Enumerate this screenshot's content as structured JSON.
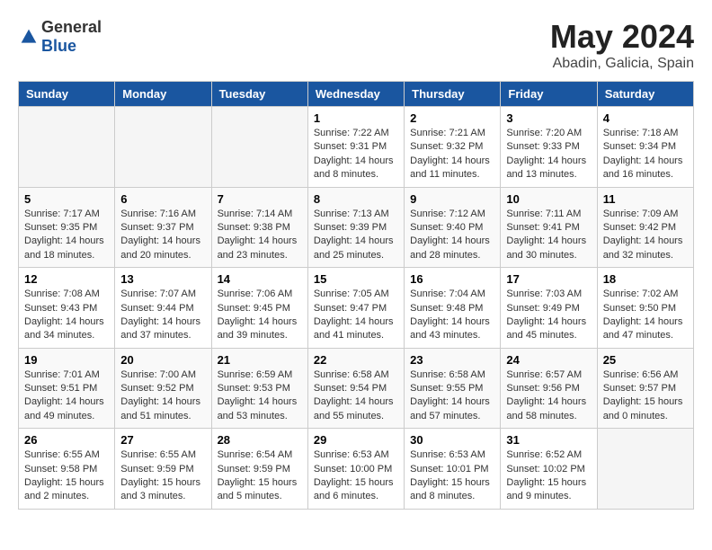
{
  "header": {
    "logo_general": "General",
    "logo_blue": "Blue",
    "month_year": "May 2024",
    "location": "Abadin, Galicia, Spain"
  },
  "weekdays": [
    "Sunday",
    "Monday",
    "Tuesday",
    "Wednesday",
    "Thursday",
    "Friday",
    "Saturday"
  ],
  "weeks": [
    [
      {
        "day": "",
        "sunrise": "",
        "sunset": "",
        "daylight": "",
        "empty": true
      },
      {
        "day": "",
        "sunrise": "",
        "sunset": "",
        "daylight": "",
        "empty": true
      },
      {
        "day": "",
        "sunrise": "",
        "sunset": "",
        "daylight": "",
        "empty": true
      },
      {
        "day": "1",
        "sunrise": "Sunrise: 7:22 AM",
        "sunset": "Sunset: 9:31 PM",
        "daylight": "Daylight: 14 hours and 8 minutes.",
        "empty": false
      },
      {
        "day": "2",
        "sunrise": "Sunrise: 7:21 AM",
        "sunset": "Sunset: 9:32 PM",
        "daylight": "Daylight: 14 hours and 11 minutes.",
        "empty": false
      },
      {
        "day": "3",
        "sunrise": "Sunrise: 7:20 AM",
        "sunset": "Sunset: 9:33 PM",
        "daylight": "Daylight: 14 hours and 13 minutes.",
        "empty": false
      },
      {
        "day": "4",
        "sunrise": "Sunrise: 7:18 AM",
        "sunset": "Sunset: 9:34 PM",
        "daylight": "Daylight: 14 hours and 16 minutes.",
        "empty": false
      }
    ],
    [
      {
        "day": "5",
        "sunrise": "Sunrise: 7:17 AM",
        "sunset": "Sunset: 9:35 PM",
        "daylight": "Daylight: 14 hours and 18 minutes.",
        "empty": false
      },
      {
        "day": "6",
        "sunrise": "Sunrise: 7:16 AM",
        "sunset": "Sunset: 9:37 PM",
        "daylight": "Daylight: 14 hours and 20 minutes.",
        "empty": false
      },
      {
        "day": "7",
        "sunrise": "Sunrise: 7:14 AM",
        "sunset": "Sunset: 9:38 PM",
        "daylight": "Daylight: 14 hours and 23 minutes.",
        "empty": false
      },
      {
        "day": "8",
        "sunrise": "Sunrise: 7:13 AM",
        "sunset": "Sunset: 9:39 PM",
        "daylight": "Daylight: 14 hours and 25 minutes.",
        "empty": false
      },
      {
        "day": "9",
        "sunrise": "Sunrise: 7:12 AM",
        "sunset": "Sunset: 9:40 PM",
        "daylight": "Daylight: 14 hours and 28 minutes.",
        "empty": false
      },
      {
        "day": "10",
        "sunrise": "Sunrise: 7:11 AM",
        "sunset": "Sunset: 9:41 PM",
        "daylight": "Daylight: 14 hours and 30 minutes.",
        "empty": false
      },
      {
        "day": "11",
        "sunrise": "Sunrise: 7:09 AM",
        "sunset": "Sunset: 9:42 PM",
        "daylight": "Daylight: 14 hours and 32 minutes.",
        "empty": false
      }
    ],
    [
      {
        "day": "12",
        "sunrise": "Sunrise: 7:08 AM",
        "sunset": "Sunset: 9:43 PM",
        "daylight": "Daylight: 14 hours and 34 minutes.",
        "empty": false
      },
      {
        "day": "13",
        "sunrise": "Sunrise: 7:07 AM",
        "sunset": "Sunset: 9:44 PM",
        "daylight": "Daylight: 14 hours and 37 minutes.",
        "empty": false
      },
      {
        "day": "14",
        "sunrise": "Sunrise: 7:06 AM",
        "sunset": "Sunset: 9:45 PM",
        "daylight": "Daylight: 14 hours and 39 minutes.",
        "empty": false
      },
      {
        "day": "15",
        "sunrise": "Sunrise: 7:05 AM",
        "sunset": "Sunset: 9:47 PM",
        "daylight": "Daylight: 14 hours and 41 minutes.",
        "empty": false
      },
      {
        "day": "16",
        "sunrise": "Sunrise: 7:04 AM",
        "sunset": "Sunset: 9:48 PM",
        "daylight": "Daylight: 14 hours and 43 minutes.",
        "empty": false
      },
      {
        "day": "17",
        "sunrise": "Sunrise: 7:03 AM",
        "sunset": "Sunset: 9:49 PM",
        "daylight": "Daylight: 14 hours and 45 minutes.",
        "empty": false
      },
      {
        "day": "18",
        "sunrise": "Sunrise: 7:02 AM",
        "sunset": "Sunset: 9:50 PM",
        "daylight": "Daylight: 14 hours and 47 minutes.",
        "empty": false
      }
    ],
    [
      {
        "day": "19",
        "sunrise": "Sunrise: 7:01 AM",
        "sunset": "Sunset: 9:51 PM",
        "daylight": "Daylight: 14 hours and 49 minutes.",
        "empty": false
      },
      {
        "day": "20",
        "sunrise": "Sunrise: 7:00 AM",
        "sunset": "Sunset: 9:52 PM",
        "daylight": "Daylight: 14 hours and 51 minutes.",
        "empty": false
      },
      {
        "day": "21",
        "sunrise": "Sunrise: 6:59 AM",
        "sunset": "Sunset: 9:53 PM",
        "daylight": "Daylight: 14 hours and 53 minutes.",
        "empty": false
      },
      {
        "day": "22",
        "sunrise": "Sunrise: 6:58 AM",
        "sunset": "Sunset: 9:54 PM",
        "daylight": "Daylight: 14 hours and 55 minutes.",
        "empty": false
      },
      {
        "day": "23",
        "sunrise": "Sunrise: 6:58 AM",
        "sunset": "Sunset: 9:55 PM",
        "daylight": "Daylight: 14 hours and 57 minutes.",
        "empty": false
      },
      {
        "day": "24",
        "sunrise": "Sunrise: 6:57 AM",
        "sunset": "Sunset: 9:56 PM",
        "daylight": "Daylight: 14 hours and 58 minutes.",
        "empty": false
      },
      {
        "day": "25",
        "sunrise": "Sunrise: 6:56 AM",
        "sunset": "Sunset: 9:57 PM",
        "daylight": "Daylight: 15 hours and 0 minutes.",
        "empty": false
      }
    ],
    [
      {
        "day": "26",
        "sunrise": "Sunrise: 6:55 AM",
        "sunset": "Sunset: 9:58 PM",
        "daylight": "Daylight: 15 hours and 2 minutes.",
        "empty": false
      },
      {
        "day": "27",
        "sunrise": "Sunrise: 6:55 AM",
        "sunset": "Sunset: 9:59 PM",
        "daylight": "Daylight: 15 hours and 3 minutes.",
        "empty": false
      },
      {
        "day": "28",
        "sunrise": "Sunrise: 6:54 AM",
        "sunset": "Sunset: 9:59 PM",
        "daylight": "Daylight: 15 hours and 5 minutes.",
        "empty": false
      },
      {
        "day": "29",
        "sunrise": "Sunrise: 6:53 AM",
        "sunset": "Sunset: 10:00 PM",
        "daylight": "Daylight: 15 hours and 6 minutes.",
        "empty": false
      },
      {
        "day": "30",
        "sunrise": "Sunrise: 6:53 AM",
        "sunset": "Sunset: 10:01 PM",
        "daylight": "Daylight: 15 hours and 8 minutes.",
        "empty": false
      },
      {
        "day": "31",
        "sunrise": "Sunrise: 6:52 AM",
        "sunset": "Sunset: 10:02 PM",
        "daylight": "Daylight: 15 hours and 9 minutes.",
        "empty": false
      },
      {
        "day": "",
        "sunrise": "",
        "sunset": "",
        "daylight": "",
        "empty": true
      }
    ]
  ]
}
